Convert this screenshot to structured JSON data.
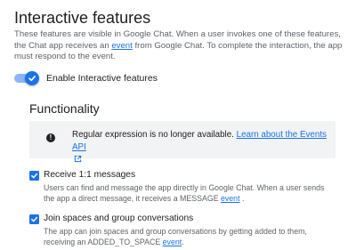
{
  "section": {
    "title": "Interactive features",
    "desc_part1": "These features are visible in Google Chat. When a user invokes one of these features, the Chat app receives an ",
    "desc_link": "event",
    "desc_part2": " from Google Chat. To complete the interaction, the app must respond to the event."
  },
  "toggle": {
    "label": "Enable Interactive features",
    "enabled": true,
    "color": "#1a73e8"
  },
  "functionality": {
    "title": "Functionality",
    "banner": {
      "icon": "info-icon",
      "text": "Regular expression is no longer available. ",
      "link": "Learn about the Events API"
    },
    "options": [
      {
        "label": "Receive 1:1 messages",
        "checked": true,
        "desc_part1": "Users can find and message the app directly in Google Chat. When a user sends the app a direct message, it receives a MESSAGE ",
        "desc_link": "event",
        "desc_part2": " ."
      },
      {
        "label": "Join spaces and group conversations",
        "checked": true,
        "desc_part1": "The app can join spaces and group conversations by getting added to them, receiving an ADDED_TO_SPACE ",
        "desc_link": "event",
        "desc_part2": "."
      }
    ]
  }
}
